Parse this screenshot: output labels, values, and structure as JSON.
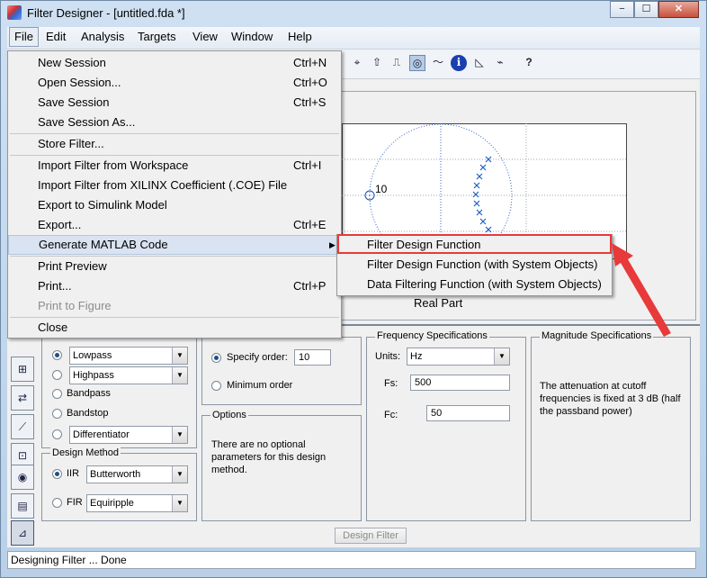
{
  "window": {
    "title": "Filter Designer - [untitled.fda *]",
    "minimize": "−",
    "maximize": "☐",
    "close": "✕"
  },
  "menubar": [
    "File",
    "Edit",
    "Analysis",
    "Targets",
    "View",
    "Window",
    "Help"
  ],
  "file_menu": {
    "items": [
      {
        "label": "New Session",
        "shortcut": "Ctrl+N"
      },
      {
        "label": "Open Session...",
        "shortcut": "Ctrl+O"
      },
      {
        "label": "Save Session",
        "shortcut": "Ctrl+S"
      },
      {
        "label": "Save Session As...",
        "shortcut": ""
      },
      {
        "label": "Store Filter...",
        "shortcut": ""
      },
      {
        "label": "Import Filter from Workspace",
        "shortcut": "Ctrl+I"
      },
      {
        "label": "Import Filter from XILINX Coefficient (.COE) File",
        "shortcut": ""
      },
      {
        "label": "Export to Simulink Model",
        "shortcut": ""
      },
      {
        "label": "Export...",
        "shortcut": "Ctrl+E"
      },
      {
        "label": "Generate MATLAB Code",
        "shortcut": "▶"
      },
      {
        "label": "Print Preview",
        "shortcut": ""
      },
      {
        "label": "Print...",
        "shortcut": "Ctrl+P"
      },
      {
        "label": "Print to Figure",
        "shortcut": ""
      },
      {
        "label": "Close",
        "shortcut": ""
      }
    ]
  },
  "submenu": {
    "items": [
      "Filter Design Function",
      "Filter Design Function (with System Objects)",
      "Data Filtering Function (with System Objects)"
    ]
  },
  "toolbar_icons": [
    "⌖",
    "⇧",
    "⎍",
    "◎",
    "〜",
    "ℹ",
    "◺",
    "⌁",
    "?"
  ],
  "plot": {
    "xlabel": "Real Part",
    "annotation": "10"
  },
  "response_type": {
    "options": [
      "Lowpass",
      "Highpass",
      "Bandpass",
      "Bandstop",
      "Differentiator"
    ]
  },
  "design_method": {
    "title": "Design Method",
    "iir_label": "IIR",
    "iir_value": "Butterworth",
    "fir_label": "FIR",
    "fir_value": "Equiripple"
  },
  "filter_order": {
    "specify_label": "Specify order:",
    "specify_value": "10",
    "minimum_label": "Minimum order"
  },
  "options": {
    "title": "Options",
    "text": "There are no optional parameters for this design method."
  },
  "freq_specs": {
    "title": "Frequency Specifications",
    "units_label": "Units:",
    "units_value": "Hz",
    "fs_label": "Fs:",
    "fs_value": "500",
    "fc_label": "Fc:",
    "fc_value": "50"
  },
  "mag_specs": {
    "title": "Magnitude Specifications",
    "text": "The attenuation at cutoff frequencies is fixed at 3 dB (half the passband power)"
  },
  "design_button": "Design Filter",
  "status": "Designing Filter ... Done",
  "sidebar_icons": [
    "⊞",
    "⇄",
    "⟋",
    "⊡",
    "◉",
    "▤",
    "⊿"
  ]
}
